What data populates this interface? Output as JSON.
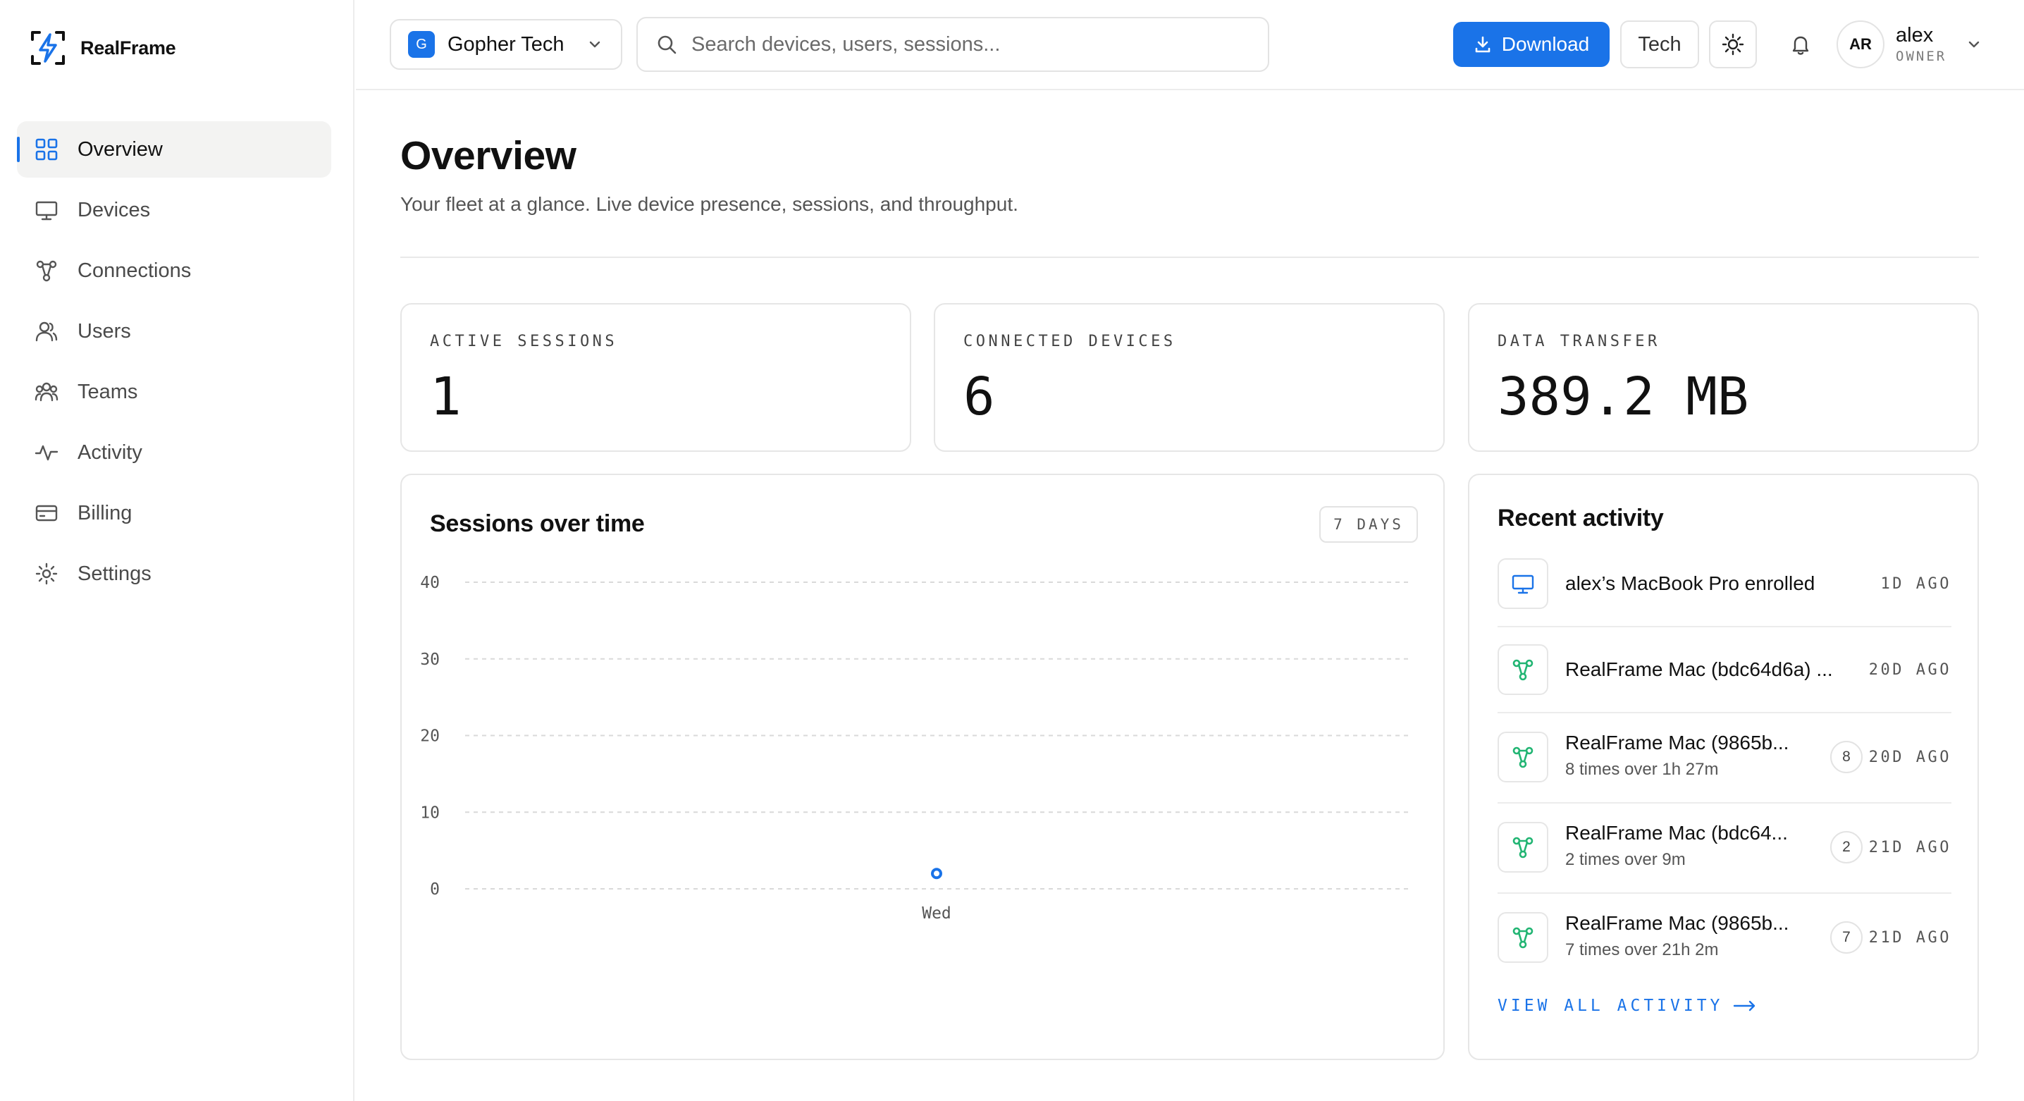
{
  "brand": {
    "name": "RealFrame"
  },
  "sidebar": {
    "items": [
      {
        "label": "Overview",
        "icon": "grid-icon",
        "active": true
      },
      {
        "label": "Devices",
        "icon": "monitor-icon"
      },
      {
        "label": "Connections",
        "icon": "nodes-icon"
      },
      {
        "label": "Users",
        "icon": "user-icon"
      },
      {
        "label": "Teams",
        "icon": "team-icon"
      },
      {
        "label": "Activity",
        "icon": "pulse-icon"
      },
      {
        "label": "Billing",
        "icon": "card-icon"
      },
      {
        "label": "Settings",
        "icon": "gear-icon"
      }
    ]
  },
  "header": {
    "org": {
      "badge": "G",
      "name": "Gopher Tech"
    },
    "search": {
      "placeholder": "Search devices, users, sessions..."
    },
    "download_label": "Download",
    "tech_label": "Tech",
    "user": {
      "initials": "AR",
      "name": "alex",
      "role": "OWNER"
    }
  },
  "main": {
    "title": "Overview",
    "subtitle": "Your fleet at a glance. Live device presence, sessions, and throughput.",
    "stats": [
      {
        "label": "ACTIVE SESSIONS",
        "value": "1"
      },
      {
        "label": "CONNECTED DEVICES",
        "value": "6"
      },
      {
        "label": "DATA TRANSFER",
        "value": "389.2 MB"
      }
    ],
    "sessions_card": {
      "title": "Sessions over time",
      "range": "7 DAYS"
    },
    "activity": {
      "title": "Recent activity",
      "items": [
        {
          "icon": "monitor-icon",
          "title": "alex’s MacBook Pro enrolled",
          "sub": "",
          "count": "",
          "time": "1D AGO"
        },
        {
          "icon": "nodes-icon",
          "title": "RealFrame Mac (bdc64d6a) ...",
          "sub": "",
          "count": "",
          "time": "20D AGO"
        },
        {
          "icon": "nodes-icon",
          "title": "RealFrame Mac (9865b...",
          "sub": "8 times over 1h 27m",
          "count": "8",
          "time": "20D AGO"
        },
        {
          "icon": "nodes-icon",
          "title": "RealFrame Mac (bdc64...",
          "sub": "2 times over 9m",
          "count": "2",
          "time": "21D AGO"
        },
        {
          "icon": "nodes-icon",
          "title": "RealFrame Mac (9865b...",
          "sub": "7 times over 21h 2m",
          "count": "7",
          "time": "21D AGO"
        }
      ],
      "view_all": "VIEW ALL ACTIVITY"
    }
  },
  "colors": {
    "accent": "#1a73e8",
    "activity_icon": "#22b573",
    "border": "#e6e6e6"
  },
  "chart_data": {
    "type": "scatter",
    "title": "Sessions over time",
    "categories": [
      "Wed"
    ],
    "values": [
      2
    ],
    "ylim": [
      0,
      40
    ],
    "yticks": [
      0,
      10,
      20,
      30,
      40
    ],
    "xlabel": "",
    "ylabel": "",
    "grid": true
  }
}
